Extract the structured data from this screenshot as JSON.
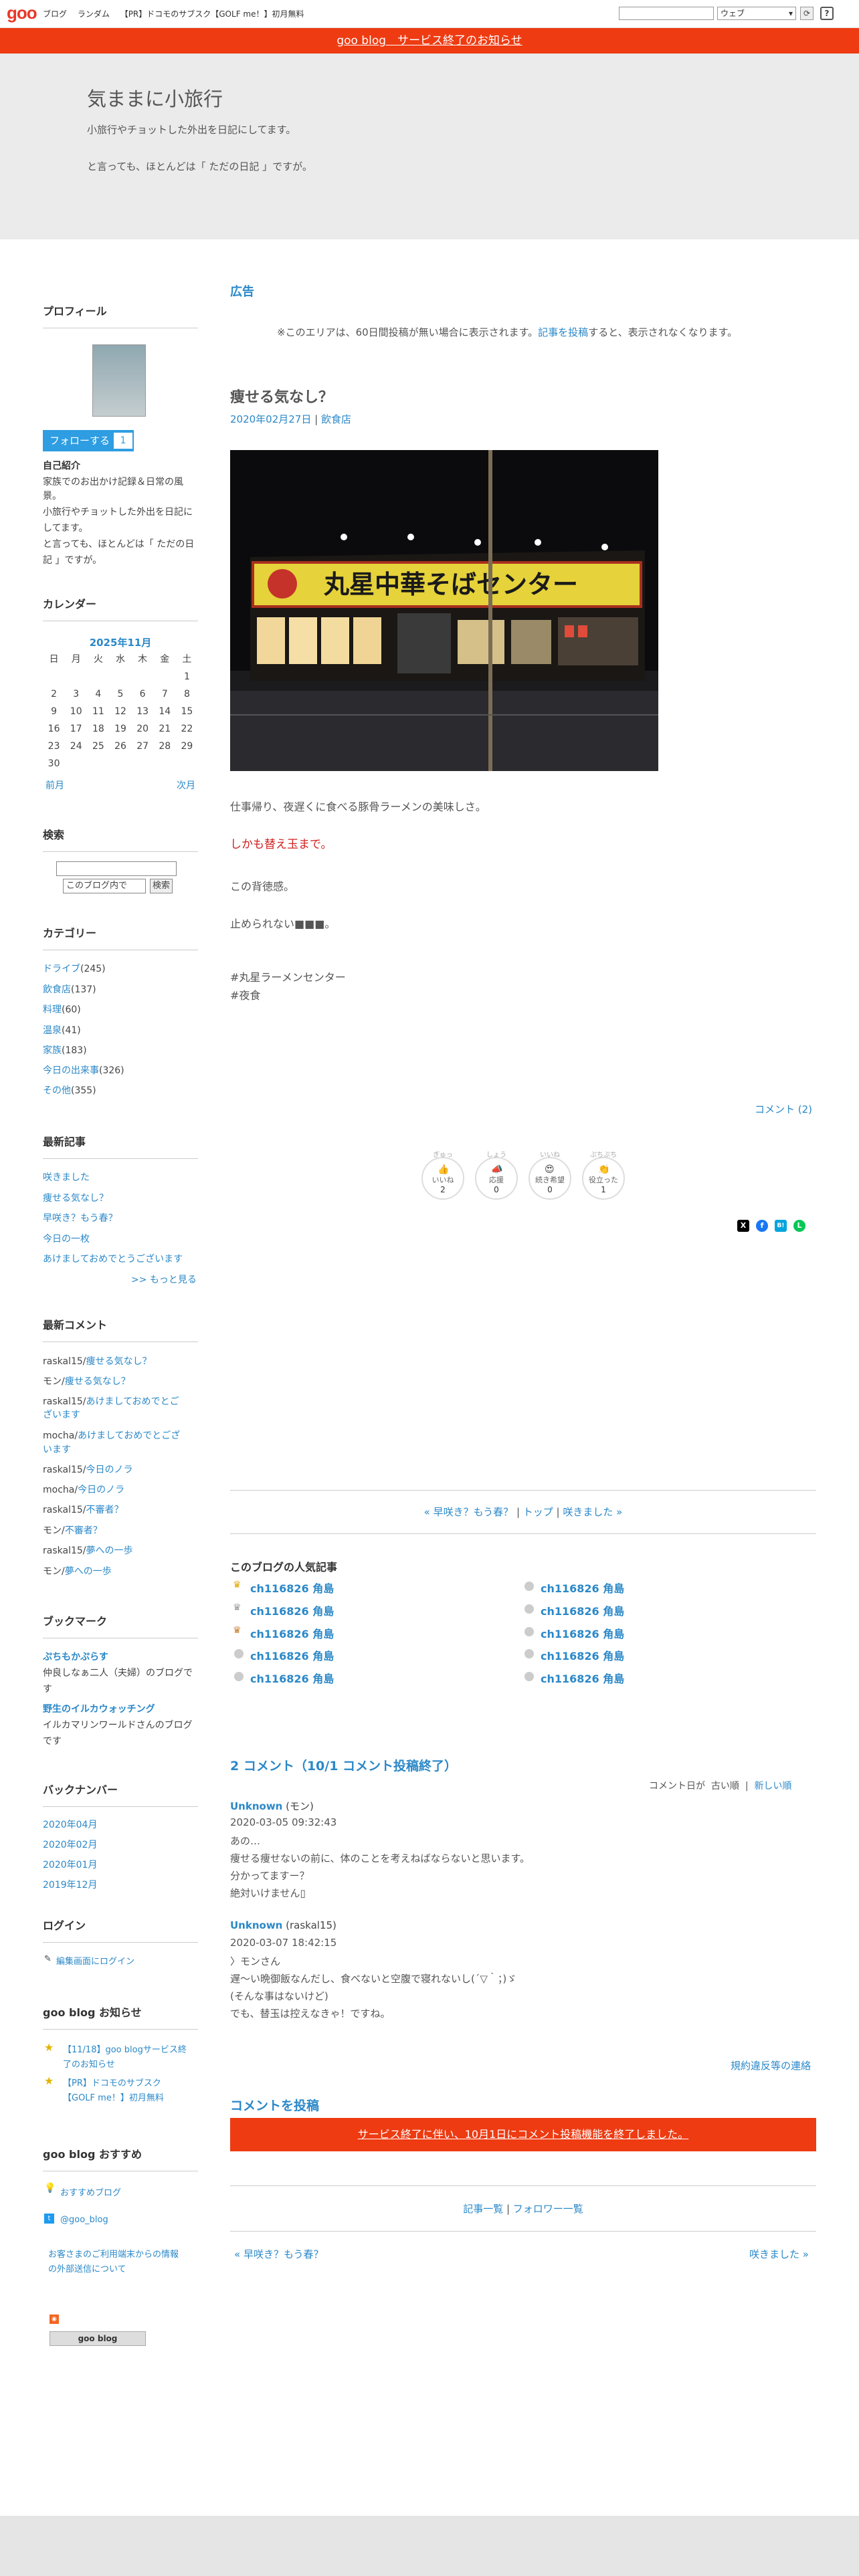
{
  "topbar": {
    "logo": "goo",
    "nav": [
      "ブログ",
      "ランダム",
      "【PR】ドコモのサブスク【GOLF me！】初月無料"
    ],
    "search_scope": "ウェブ"
  },
  "notice": {
    "text": "goo blog　サービス終了のお知らせ"
  },
  "header": {
    "title": "気ままに小旅行",
    "desc1": "小旅行やチョットした外出を日記にしてます。",
    "desc2": "と言っても、ほとんどは「 ただの日記 」ですが。"
  },
  "sidebar": {
    "profile": {
      "heading": "プロフィール",
      "follow_label": "フォローする",
      "follow_count": "1",
      "intro_heading": "自己紹介",
      "intro_lines": [
        "家族でのお出かけ記録＆日常の風",
        "景。",
        "小旅行やチョットした外出を日記に",
        "してます。",
        "と言っても、ほとんどは「 ただの日",
        "記 」ですが。"
      ]
    },
    "calendar": {
      "heading": "カレンダー",
      "month": "2025年11月",
      "weekdays": [
        "日",
        "月",
        "火",
        "水",
        "木",
        "金",
        "土"
      ],
      "weeks": [
        [
          "",
          "",
          "",
          "",
          "",
          "",
          "1"
        ],
        [
          "2",
          "3",
          "4",
          "5",
          "6",
          "7",
          "8"
        ],
        [
          "9",
          "10",
          "11",
          "12",
          "13",
          "14",
          "15"
        ],
        [
          "16",
          "17",
          "18",
          "19",
          "20",
          "21",
          "22"
        ],
        [
          "23",
          "24",
          "25",
          "26",
          "27",
          "28",
          "29"
        ],
        [
          "30",
          "",
          "",
          "",
          "",
          "",
          ""
        ]
      ],
      "prev": "前月",
      "next": "次月"
    },
    "search": {
      "heading": "検索",
      "scope": "このブログ内で",
      "button": "検索"
    },
    "categories": {
      "heading": "カテゴリー",
      "items": [
        {
          "name": "ドライブ",
          "count": "(245)"
        },
        {
          "name": "飲食店",
          "count": "(137)"
        },
        {
          "name": "料理",
          "count": "(60)"
        },
        {
          "name": "温泉",
          "count": "(41)"
        },
        {
          "name": "家族",
          "count": "(183)"
        },
        {
          "name": "今日の出来事",
          "count": "(326)"
        },
        {
          "name": "その他",
          "count": "(355)"
        }
      ]
    },
    "recent_posts": {
      "heading": "最新記事",
      "items": [
        "咲きました",
        "痩せる気なし？",
        "早咲き？もう春？",
        "今日の一枚",
        "あけましておめでとうございます"
      ],
      "more": ">> もっと見る"
    },
    "recent_comments": {
      "heading": "最新コメント",
      "items": [
        {
          "author": "raskal15/",
          "lines": [
            "痩せる気なし？"
          ]
        },
        {
          "author": "モン/",
          "lines": [
            "痩せる気なし？"
          ]
        },
        {
          "author": "raskal15/",
          "lines": [
            "あけましておめでとご",
            "ざいます"
          ]
        },
        {
          "author": "mocha/",
          "lines": [
            "あけましておめでとござ",
            "います"
          ]
        },
        {
          "author": "raskal15/",
          "lines": [
            "今日のノラ"
          ]
        },
        {
          "author": "mocha/",
          "lines": [
            "今日のノラ"
          ]
        },
        {
          "author": "raskal15/",
          "lines": [
            "不審者？"
          ]
        },
        {
          "author": "モン/",
          "lines": [
            "不審者？"
          ]
        },
        {
          "author": "raskal15/",
          "lines": [
            "夢への一歩"
          ]
        },
        {
          "author": "モン/",
          "lines": [
            "夢への一歩"
          ]
        }
      ]
    },
    "bookmarks": {
      "heading": "ブックマーク",
      "items": [
        {
          "name": "ぷちもかぷらす",
          "desc": [
            "仲良しなぁ二人（夫婦）のブログで",
            "す"
          ]
        },
        {
          "name": "野生のイルカウォッチング",
          "desc": [
            "イルカマリンワールドさんのブログ",
            "です"
          ]
        }
      ]
    },
    "backnumber": {
      "heading": "バックナンバー",
      "items": [
        "2020年04月",
        "2020年02月",
        "2020年01月",
        "2019年12月"
      ]
    },
    "login": {
      "heading": "ログイン",
      "link": "編集画面にログイン"
    },
    "goo_notice": {
      "heading": "goo blog お知らせ",
      "items": [
        [
          "【11/18】goo blogサービス終",
          "了のお知らせ"
        ],
        [
          "【PR】ドコモのサブスク",
          "【GOLF me！】初月無料"
        ]
      ]
    },
    "recommend": {
      "heading": "goo blog おすすめ",
      "items": [
        "おすすめブログ",
        "@goo_blog"
      ],
      "privacy": [
        "お客さまのご利用端末からの情報",
        "の外部送信について"
      ],
      "badge": "goo blog"
    }
  },
  "main": {
    "ad_heading": "広告",
    "ad_text_before": "※このエリアは、60日間投稿が無い場合に表示されます。",
    "ad_link": "記事を投稿",
    "ad_text_after": "すると、表示されなくなります。",
    "post": {
      "title": "痩せる気なし？",
      "date": "2020年02月27日",
      "sep": " | ",
      "category": "飲食店",
      "sign_text": "丸星中華そばセンター",
      "body": {
        "line1": "仕事帰り、夜遅くに食べる豚骨ラーメンの美味しさ。",
        "line2": "しかも替え玉まで。",
        "line3": "この背徳感。",
        "line4": "止められない■■■。",
        "tag1": "#丸星ラーメンセンター",
        "tag2": "#夜食"
      },
      "comment_link": "コメント (2)"
    },
    "reactions": [
      {
        "label": "いいね",
        "count": "2",
        "top": "ぎゅっ",
        "icon": "👍"
      },
      {
        "label": "応援",
        "count": "0",
        "top": "しょう",
        "icon": "📣"
      },
      {
        "label": "続き希望",
        "count": "0",
        "top": "いいね",
        "icon": "😍"
      },
      {
        "label": "役立った",
        "count": "1",
        "top": "ぷちぷち",
        "icon": "👏"
      }
    ],
    "share_icons": [
      "X",
      "f",
      "B!",
      "L"
    ],
    "pager": {
      "prev": "« 早咲き？もう春？",
      "top": "トップ",
      "next": "咲きました »",
      "sep": " | "
    },
    "popular": {
      "heading": "このブログの人気記事",
      "left": [
        "ch116826 角島",
        "ch116826 角島",
        "ch116826 角島",
        "ch116826 角島",
        "ch116826 角島"
      ],
      "right": [
        "ch116826 角島",
        "ch116826 角島",
        "ch116826 角島",
        "ch116826 角島",
        "ch116826 角島"
      ]
    },
    "comments": {
      "heading": "2 コメント（10/1 コメント投稿終了）",
      "sort_label": "コメント日が",
      "sort_old": "古い順",
      "sort_sep": "|",
      "sort_new": "新しい順",
      "items": [
        {
          "name": "Unknown",
          "handle": " (モン)",
          "date": "2020-03-05 09:32:43",
          "lines": [
            "あの…",
            "痩せる痩せないの前に、体のことを考えねばならないと思います。",
            "分かってますー？",
            "絶対いけません▯"
          ]
        },
        {
          "name": "Unknown",
          "handle": " (raskal15)",
          "date": "2020-03-07 18:42:15",
          "lines": [
            "〉モンさん",
            "遅〜い晩御飯なんだし、食べないと空腹で寝れないし(´▽｀；)ゞ",
            "(そんな事はないけど)",
            "でも、替玉は控えなきゃ！ですね。"
          ]
        }
      ],
      "report": "規約違反等の連絡"
    },
    "post_comment_heading": "コメントを投稿",
    "post_comment_notice": "サービス終了に伴い、10月1日にコメント投稿機能を終了しました。",
    "bottom_links": {
      "list": "記事一覧",
      "sep": " | ",
      "follow": "フォロワー一覧"
    },
    "bottom_pager": {
      "prev": "« 早咲き？もう春？",
      "next": "咲きました »"
    }
  }
}
